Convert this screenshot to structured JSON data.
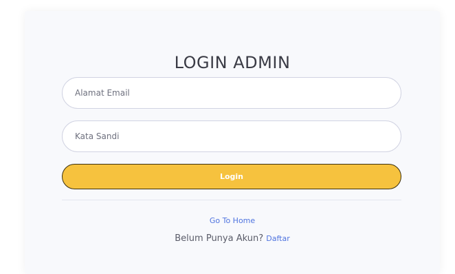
{
  "login_form": {
    "title": "LOGIN ADMIN",
    "email_placeholder": "Alamat Email",
    "email_value": "",
    "password_placeholder": "Kata Sandi",
    "password_value": "",
    "login_label": "Login",
    "home_link_label": "Go To Home",
    "register_prompt": "Belum Punya Akun?",
    "register_link_label": "Daftar"
  },
  "colors": {
    "card_background": "#f8f9fc",
    "login_button": "#f6c23e",
    "link": "#4e73df",
    "title_text": "#3a3b45"
  }
}
